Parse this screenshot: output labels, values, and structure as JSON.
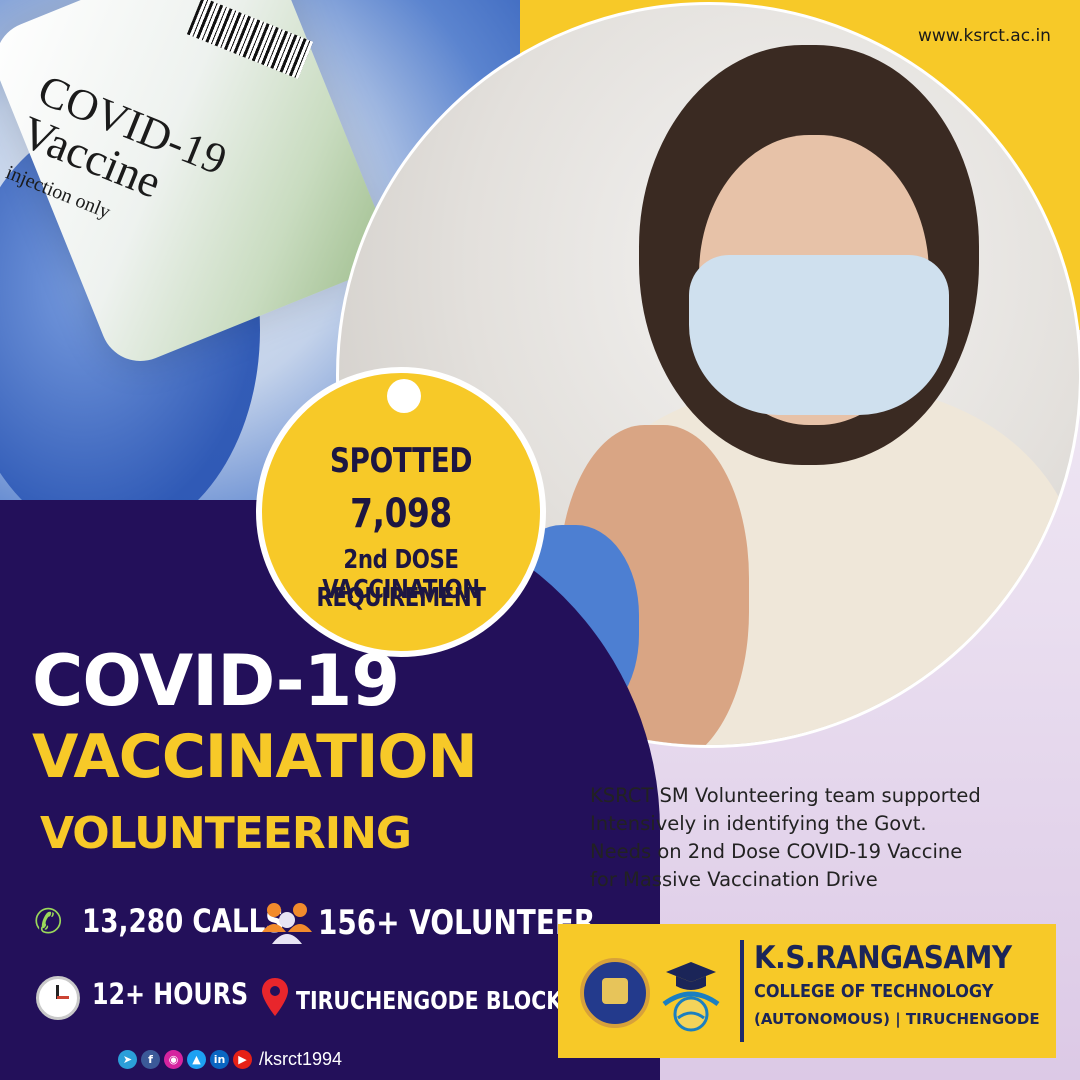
{
  "website": "www.ksrct.ac.in",
  "vial_label": {
    "line1": "COVID-19",
    "line2": "Vaccine",
    "line3": "injection only"
  },
  "badge": {
    "line1": "SPOTTED",
    "count": "7,098",
    "line3": "2nd DOSE VACCINATION",
    "line4": "REQUIREMENT"
  },
  "title": {
    "line1": "COVID-19",
    "line2": "VACCINATION",
    "line3": "VOLUNTEERING"
  },
  "stats": {
    "calls": "13,280 CALLS",
    "volunteers": "156+ VOLUNTEER",
    "hours": "12+ HOURS",
    "block": "TIRUCHENGODE BLOCK"
  },
  "description": "KSRCT SM Volunteering team supported Intensively in identifying the Govt. Needs on 2nd Dose COVID-19 Vaccine for Massive Vaccination Drive",
  "college": {
    "name": "K.S.RANGASAMY",
    "subtitle": "COLLEGE OF TECHNOLOGY",
    "location": "(AUTONOMOUS) | TIRUCHENGODE"
  },
  "social": {
    "handle": "/ksrct1994",
    "icons": [
      "telegram-icon",
      "facebook-icon",
      "instagram-icon",
      "twitter-icon",
      "linkedin-icon",
      "youtube-icon"
    ]
  },
  "colors": {
    "accent_yellow": "#f7c928",
    "panel_purple": "#23105a",
    "navy_text": "#1b2558"
  }
}
